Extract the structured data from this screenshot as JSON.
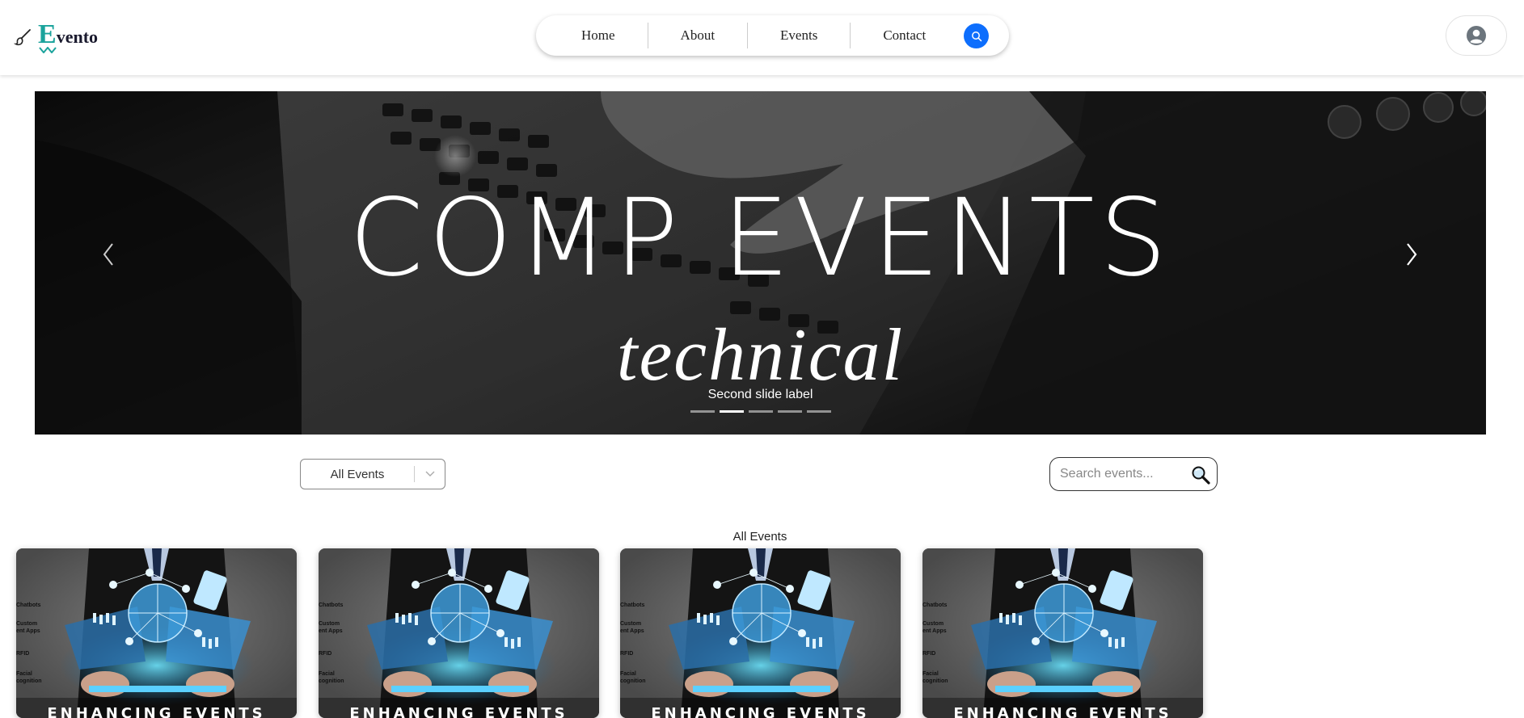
{
  "brand": {
    "logo_first": "E",
    "logo_rest": "vento"
  },
  "nav": {
    "items": [
      "Home",
      "About",
      "Events",
      "Contact"
    ]
  },
  "carousel": {
    "title": "COMP EVENTS",
    "subtitle": "technical",
    "caption": "Second slide label",
    "slide_count": 5,
    "active_index": 1
  },
  "filter": {
    "selected": "All Events"
  },
  "search": {
    "placeholder": "Search events..."
  },
  "section_title": "All Events",
  "cards": [
    {
      "label_left": [
        "Chatbots",
        "Custom",
        "ent Apps",
        "RFID",
        "Facial",
        "cognition"
      ],
      "banner": "ENHANCING EVENTS"
    },
    {
      "label_left": [
        "Chatbots",
        "Custom",
        "ent Apps",
        "RFID",
        "Facial",
        "cognition"
      ],
      "banner": "ENHANCING EVENTS"
    },
    {
      "label_left": [
        "Chatbots",
        "Custom",
        "ent Apps",
        "RFID",
        "Facial",
        "cognition"
      ],
      "banner": "ENHANCING EVENTS"
    },
    {
      "label_left": [
        "Chatbots",
        "Custom",
        "ent Apps",
        "RFID",
        "Facial",
        "cognition"
      ],
      "banner": "ENHANCING EVENTS"
    }
  ],
  "colors": {
    "accent": "#0d6efd",
    "logo_teal": "#1ba39c"
  },
  "icons": {
    "logo": "brush-icon",
    "nav_search": "search-icon",
    "user": "user-avatar-icon",
    "prev": "chevron-left-icon",
    "next": "chevron-right-icon",
    "filter": "chevron-down-icon",
    "search_box": "magnifier-icon"
  }
}
